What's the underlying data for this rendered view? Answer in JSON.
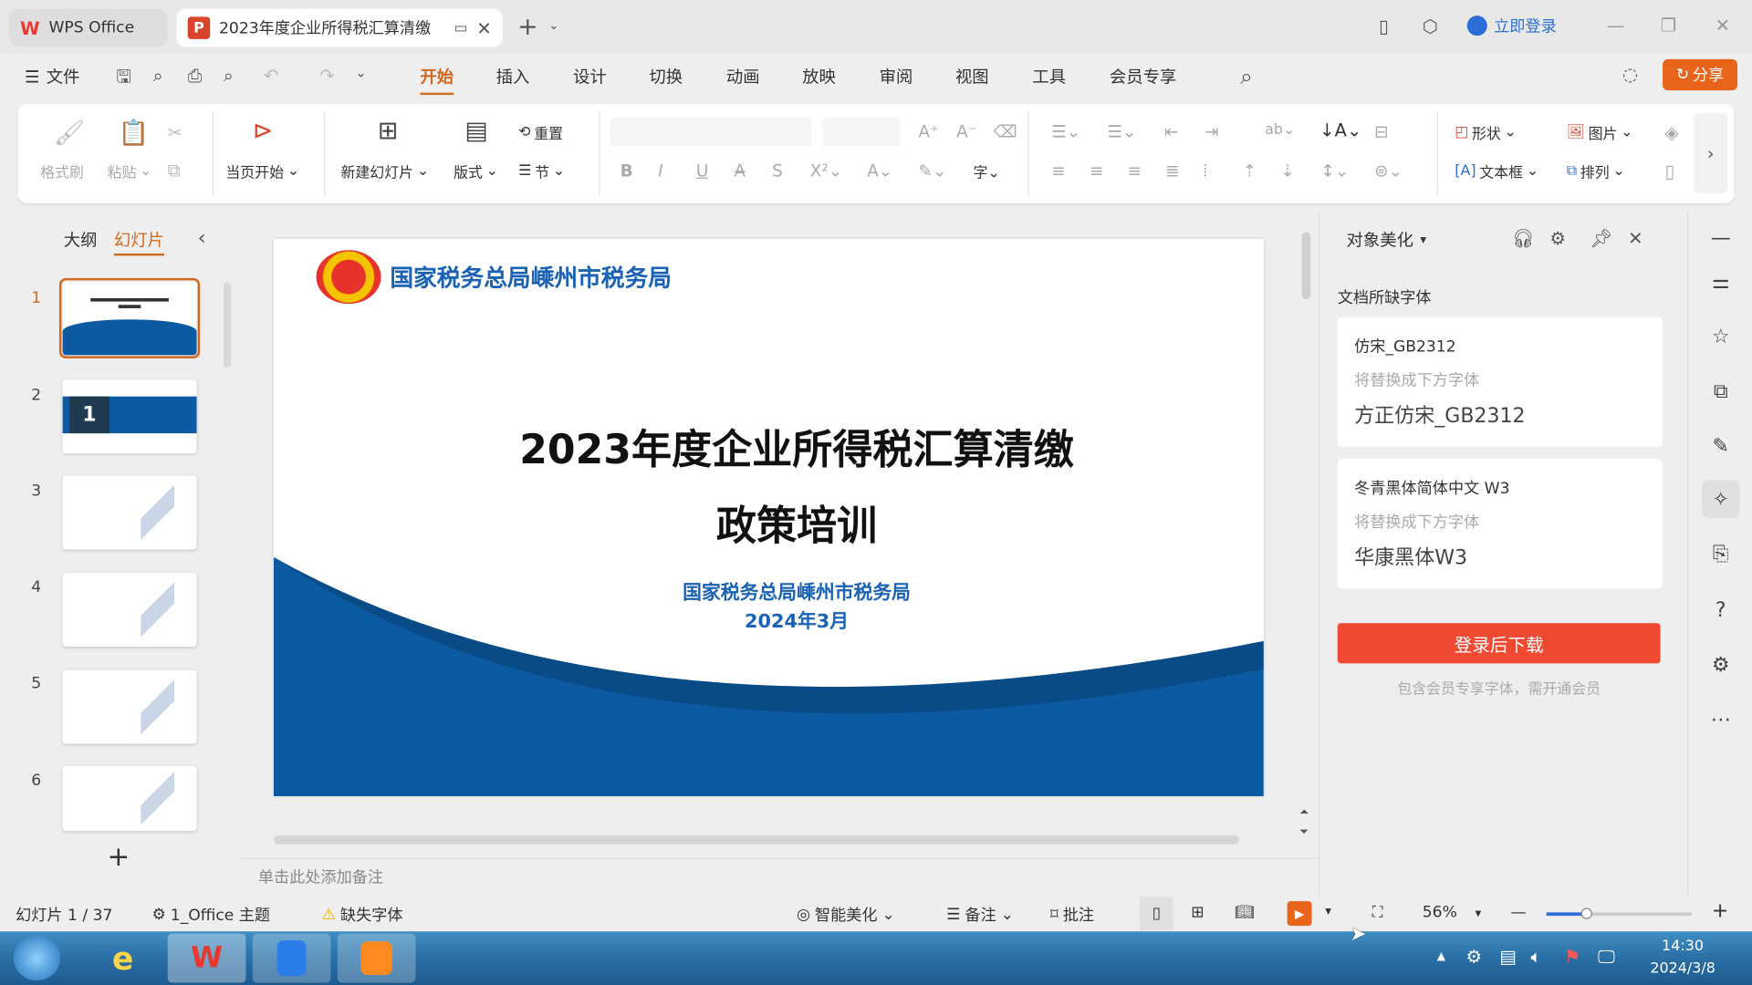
{
  "titlebar": {
    "home_tab": "WPS Office",
    "doc_tab": "2023年度企业所得税汇算清缴",
    "login": "立即登录"
  },
  "menubar": {
    "file": "文件",
    "tabs": [
      "开始",
      "插入",
      "设计",
      "切换",
      "动画",
      "放映",
      "审阅",
      "视图",
      "工具",
      "会员专享"
    ],
    "active_tab": "开始",
    "share": "分享"
  },
  "ribbon": {
    "format_painter": "格式刷",
    "paste": "粘贴",
    "play_from_current": "当页开始",
    "new_slide": "新建幻灯片",
    "layout": "版式",
    "reset": "重置",
    "section": "节",
    "shape": "形状",
    "picture": "图片",
    "textbox": "文本框",
    "arrange": "排列"
  },
  "left_panel": {
    "tabs": [
      "大纲",
      "幻灯片"
    ],
    "active_tab": "幻灯片",
    "slide_numbers": [
      "1",
      "2",
      "3",
      "4",
      "5",
      "6"
    ],
    "selected_slide": 1
  },
  "slide": {
    "header_org": "国家税务总局嵊州市税务局",
    "title_line1": "2023年度企业所得税汇算清缴",
    "title_line2": "政策培训",
    "org": "国家税务总局嵊州市税务局",
    "date": "2024年3月",
    "thumb2_number": "1"
  },
  "notes_placeholder": "单击此处添加备注",
  "right_panel": {
    "title": "对象美化",
    "section": "文档所缺字体",
    "fonts": [
      {
        "missing": "仿宋_GB2312",
        "hint": "将替换成下方字体",
        "replacement": "方正仿宋_GB2312"
      },
      {
        "missing": "冬青黑体简体中文 W3",
        "hint": "将替换成下方字体",
        "replacement": "华康黑体W3"
      }
    ],
    "download_button": "登录后下载",
    "footnote": "包含会员专享字体，需开通会员"
  },
  "statusbar": {
    "slide_counter": "幻灯片 1 / 37",
    "theme": "1_Office 主题",
    "missing_font": "缺失字体",
    "smart_beautify": "智能美化",
    "notes": "备注",
    "comments": "批注",
    "zoom": "56%",
    "zoom_fraction": 0.56
  },
  "taskbar": {
    "time": "14:30",
    "date": "2024/3/8"
  },
  "colors": {
    "accent": "#d2691e",
    "share": "#e8641b",
    "download": "#f04a32",
    "slide_blue": "#0b5aa2",
    "login_blue": "#2b6fd6"
  }
}
